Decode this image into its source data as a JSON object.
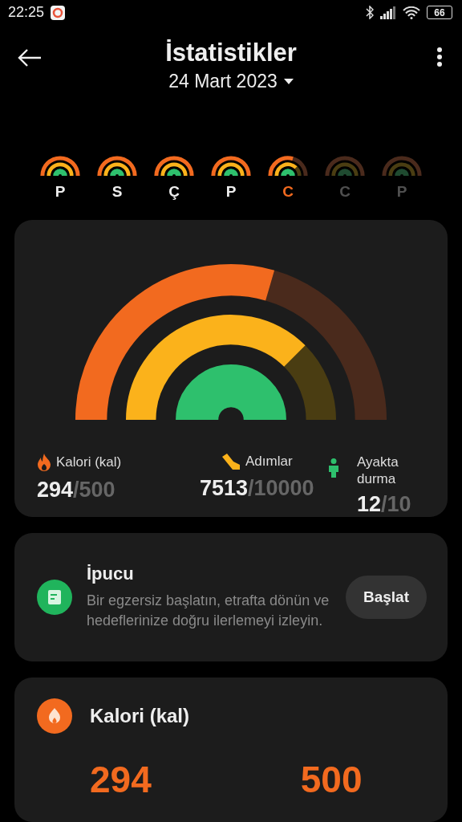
{
  "status_bar": {
    "time": "22:25",
    "battery": "66"
  },
  "header": {
    "title": "İstatistikler",
    "date": "24 Mart 2023"
  },
  "days": [
    {
      "label": "P",
      "selected": false,
      "disabled": false
    },
    {
      "label": "S",
      "selected": false,
      "disabled": false
    },
    {
      "label": "Ç",
      "selected": false,
      "disabled": false
    },
    {
      "label": "P",
      "selected": false,
      "disabled": false
    },
    {
      "label": "C",
      "selected": true,
      "disabled": false
    },
    {
      "label": "C",
      "selected": false,
      "disabled": true
    },
    {
      "label": "P",
      "selected": false,
      "disabled": true
    }
  ],
  "summary": {
    "stats": [
      {
        "kind": "calories",
        "label": "Kalori (kal)",
        "value": "294",
        "goal": "/500"
      },
      {
        "kind": "steps",
        "label": "Adımlar",
        "value": "7513",
        "goal": "/10000"
      },
      {
        "kind": "standing",
        "label": "Ayakta durma",
        "value": "12",
        "goal": "/10"
      }
    ]
  },
  "tip": {
    "title": "İpucu",
    "text": "Bir egzersiz başlatın, etrafta dönün ve hedeflerinize doğru ilerlemeyi izleyin.",
    "button": "Başlat"
  },
  "metric": {
    "title": "Kalori (kal)",
    "value": "294",
    "goal": "500"
  }
}
